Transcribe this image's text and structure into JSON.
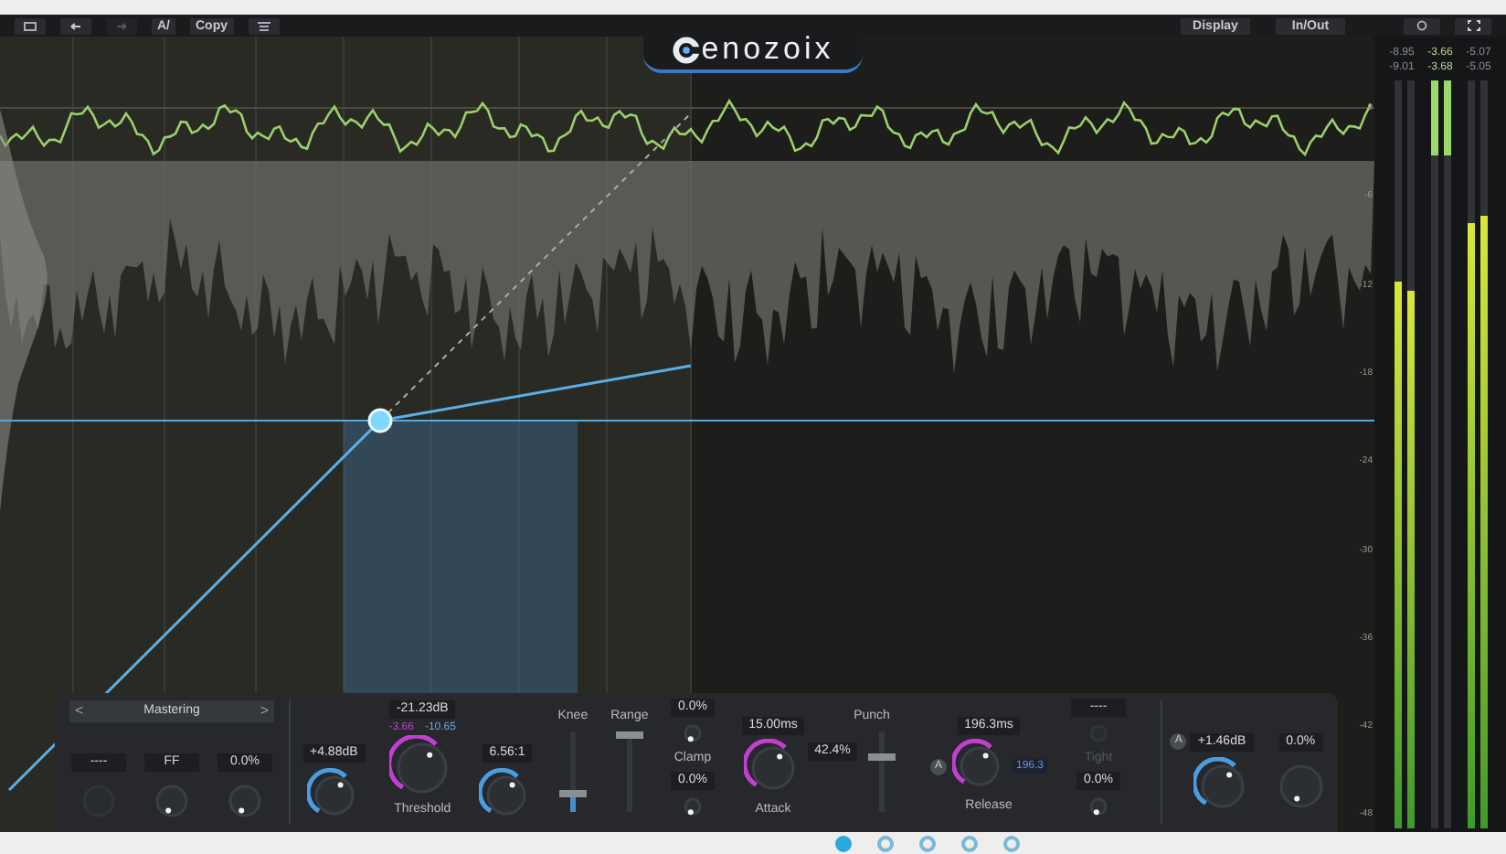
{
  "toolbar": {
    "ab_label": "A/",
    "copy_label": "Copy",
    "right_buttons": [
      "Display",
      "In/Out"
    ]
  },
  "logo": "enozoix",
  "scale_labels": [
    "0",
    "-6",
    "-12",
    "-18",
    "-24",
    "-30",
    "-36",
    "-42",
    "-48"
  ],
  "meters": {
    "readouts": [
      [
        "-8.95",
        "-3.66",
        "-5.07"
      ],
      [
        "-9.01",
        "-3.68",
        "-5.05"
      ]
    ],
    "bars": [
      {
        "kind": "input",
        "level": 0.73
      },
      {
        "kind": "input",
        "level": 0.72
      },
      {
        "kind": "reduction",
        "level": 0.1
      },
      {
        "kind": "reduction",
        "level": 0.1
      },
      {
        "kind": "output",
        "level": 0.81
      },
      {
        "kind": "output",
        "level": 0.82
      }
    ]
  },
  "panel": {
    "preset": {
      "prev": "<",
      "label": "Mastering",
      "next": ">"
    },
    "detector": [
      {
        "value": "----",
        "disabled": true
      },
      {
        "value": "FF",
        "disabled": false
      },
      {
        "value": "0.0%",
        "disabled": false
      }
    ],
    "makeup": {
      "value": "+4.88dB",
      "color": "#4a9de0"
    },
    "threshold": {
      "value": "-21.23dB",
      "peak": "-3.66",
      "rms": "-10.65",
      "color": "#c23fd0",
      "label": "Threshold"
    },
    "ratio": {
      "value": "6.56:1",
      "color": "#4a9de0"
    },
    "sliders": [
      {
        "label": "Knee",
        "level": 0.2
      },
      {
        "label": "Range",
        "level": 1.0
      }
    ],
    "clamp": {
      "value": "0.0%",
      "label": "Clamp"
    },
    "clamp_lower": {
      "value": "0.0%"
    },
    "attack": {
      "value": "15.00ms",
      "color": "#c23fd0",
      "label": "Attack"
    },
    "punch": {
      "label": "Punch",
      "value": "42.4%",
      "level": 0.7
    },
    "release": {
      "value": "196.3ms",
      "badge": "A",
      "auto_value": "196.3",
      "color": "#c23fd0",
      "label": "Release"
    },
    "tight": {
      "value": "----",
      "disabled": true,
      "label": "Tight"
    },
    "tight_lower": {
      "value": "0.0%"
    },
    "output": {
      "badge": "A",
      "value": "+1.46dB",
      "color": "#4a9de0"
    },
    "mix": {
      "value": "0.0%"
    }
  },
  "pages": [
    {
      "selected": true
    },
    {
      "selected": false
    },
    {
      "selected": false
    },
    {
      "selected": false
    },
    {
      "selected": false
    }
  ]
}
